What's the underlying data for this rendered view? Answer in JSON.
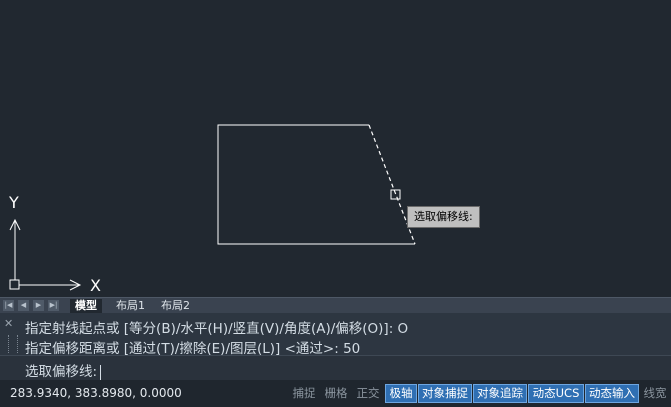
{
  "canvas": {
    "axis_x_label": "X",
    "axis_y_label": "Y",
    "tooltip": "选取偏移线:"
  },
  "tabs": {
    "nav_icons": [
      "first-icon",
      "prev-icon",
      "next-icon",
      "last-icon"
    ],
    "items": [
      {
        "label": "模型",
        "active": true
      },
      {
        "label": "布局1",
        "active": false
      },
      {
        "label": "布局2",
        "active": false
      }
    ]
  },
  "command": {
    "history": [
      "指定射线起点或 [等分(B)/水平(H)/竖直(V)/角度(A)/偏移(O)]: O",
      "指定偏移距离或 [通过(T)/擦除(E)/图层(L)] <通过>: 50"
    ],
    "prompt": "选取偏移线:"
  },
  "status": {
    "coords": "283.9340, 383.8980, 0.0000",
    "toggles": [
      {
        "label": "捕捉",
        "on": false
      },
      {
        "label": "栅格",
        "on": false
      },
      {
        "label": "正交",
        "on": false
      },
      {
        "label": "极轴",
        "on": true
      },
      {
        "label": "对象捕捉",
        "on": true
      },
      {
        "label": "对象追踪",
        "on": true
      },
      {
        "label": "动态UCS",
        "on": true
      },
      {
        "label": "动态输入",
        "on": true
      },
      {
        "label": "线宽",
        "on": false
      }
    ]
  },
  "colors": {
    "background": "#212830",
    "toggle_on": "#2f6fb3",
    "geometry": "#ffffff"
  }
}
